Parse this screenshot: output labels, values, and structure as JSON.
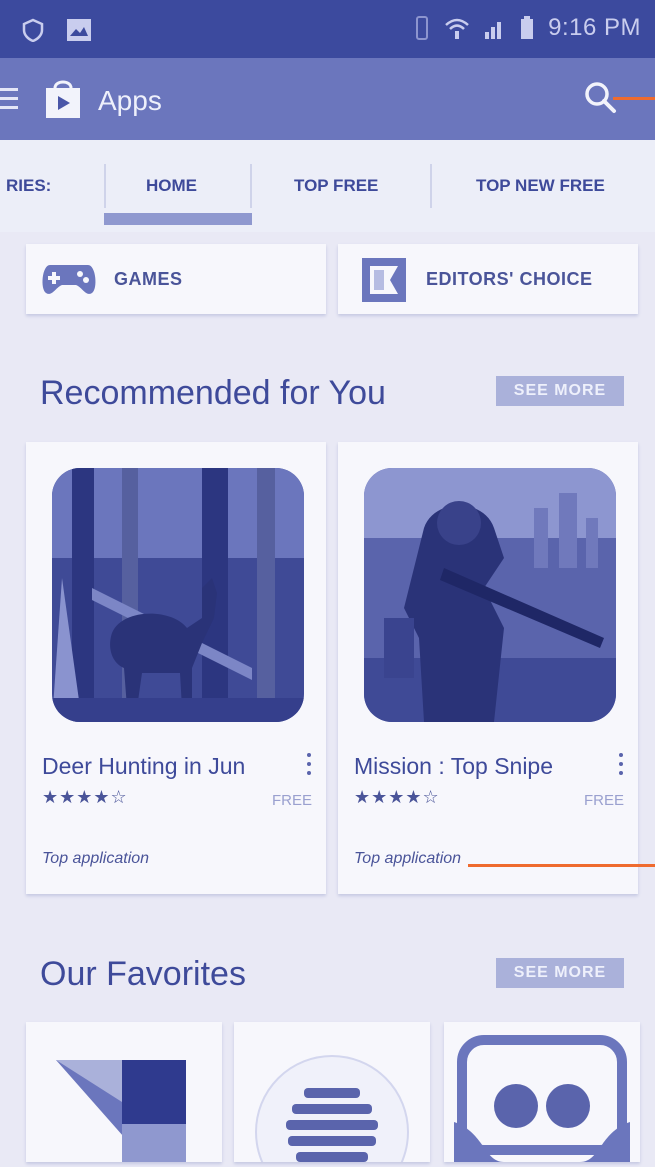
{
  "status_bar": {
    "time": "9:16 PM",
    "left_icons": [
      "shield-icon",
      "image-icon"
    ],
    "right_icons": [
      "vibrate-icon",
      "wifi-icon",
      "signal-icon",
      "battery-icon"
    ]
  },
  "app_bar": {
    "title": "Apps",
    "icons": [
      "menu-icon",
      "play-store-bag-icon",
      "search-icon"
    ]
  },
  "tabs": [
    {
      "label": "RIES:"
    },
    {
      "label": "HOME",
      "selected": true
    },
    {
      "label": "TOP FREE"
    },
    {
      "label": "TOP NEW FREE"
    }
  ],
  "chips": [
    {
      "label": "GAMES",
      "icon": "gamepad-icon"
    },
    {
      "label": "EDITORS' CHOICE",
      "icon": "editors-choice-icon"
    }
  ],
  "recommended": {
    "title": "Recommended for You",
    "see_more": "SEE MORE",
    "cards": [
      {
        "title": "Deer Hunting in Jun",
        "stars": "★★★★☆",
        "rating": 4,
        "price": "FREE",
        "tag": "Top application",
        "image": "deer-hunting-image"
      },
      {
        "title": "Mission : Top Snipe",
        "stars": "★★★★☆",
        "rating": 4,
        "price": "FREE",
        "tag": "Top application",
        "image": "sniper-soldier-image"
      }
    ]
  },
  "favorites": {
    "title": "Our Favorites",
    "see_more": "SEE MORE",
    "items": [
      "abstract-squares-icon",
      "brick-globe-icon",
      "chat-faces-icon"
    ]
  },
  "colors": {
    "status_bar": "#3c4a9e",
    "app_bar": "#6b76bd",
    "background": "#e9e9f5",
    "text": "#3e4a9a",
    "callout": "#ef6b2f"
  }
}
